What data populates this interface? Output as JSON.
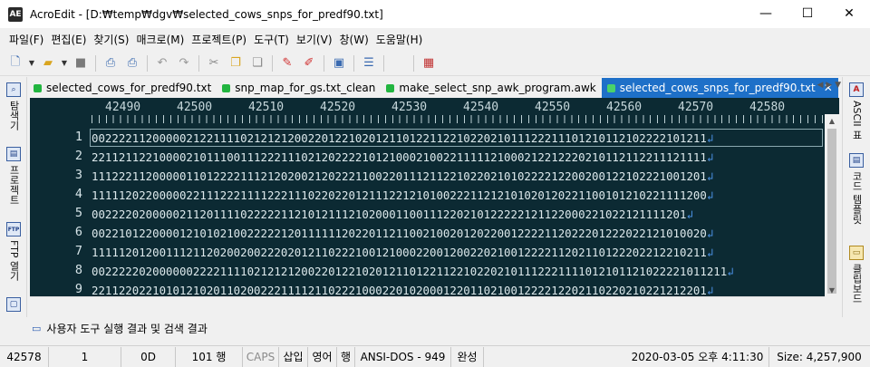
{
  "window": {
    "app_name": "AcroEdit",
    "title": "AcroEdit - [D:₩temp₩dgv₩selected_cows_snps_for_predf90.txt]",
    "app_icon": "AE",
    "controls": {
      "minimize": "—",
      "maximize": "☐",
      "close": "✕"
    }
  },
  "menu": [
    "파일(F)",
    "편집(E)",
    "찾기(S)",
    "매크로(M)",
    "프로젝트(P)",
    "도구(T)",
    "보기(V)",
    "창(W)",
    "도움말(H)"
  ],
  "toolbar_icons": [
    "new-file-icon",
    "dropdown-icon",
    "open-folder-icon",
    "dropdown-icon",
    "save-icon",
    "print-preview-icon",
    "print-icon",
    "undo-icon",
    "redo-icon",
    "cut-icon",
    "copy-icon",
    "paste-icon",
    "highlight-icon",
    "clear-icon",
    "page-icon",
    "list-icon",
    "grid-icon"
  ],
  "left_panel": {
    "tabs": [
      {
        "icon": "search-panel-icon",
        "label": "탐색기"
      },
      {
        "icon": "project-panel-icon",
        "label": "프로젝트"
      },
      {
        "icon": "ftp-panel-icon",
        "label": "FTP 열기"
      }
    ],
    "ftp_icon_text": "FTP"
  },
  "right_panel": {
    "tabs": [
      {
        "icon": "ascii-table-icon",
        "label": "ASCII 표"
      },
      {
        "icon": "code-template-icon",
        "label": "코드 템플릿"
      },
      {
        "icon": "clipboard-icon",
        "label": "클립보드"
      }
    ],
    "ascii_icon_text": "A"
  },
  "tabs": [
    {
      "label": "selected_cows_for_predf90.txt",
      "active": false
    },
    {
      "label": "snp_map_for_gs.txt_clean",
      "active": false
    },
    {
      "label": "make_select_snp_awk_program.awk",
      "active": false
    },
    {
      "label": "selected_cows_snps_for_predf90.txt",
      "active": true
    }
  ],
  "tab_close": "✕",
  "tab_nav": "◀ ▶ ▼",
  "ruler": [
    "42490",
    "42500",
    "42510",
    "42520",
    "42530",
    "42540",
    "42550",
    "42560",
    "42570",
    "42580"
  ],
  "lines": [
    {
      "no": "1",
      "text": "0022221120000021221111021212120022012210201211012211221022021011122211101210112102222101211"
    },
    {
      "no": "2",
      "text": "2211211221000021011100111222111021202222101210002100221111121000212212220210112112211121111"
    },
    {
      "no": "3",
      "text": "1112221120000011012222111212020021202221100220111211221022021010222212200200122102221001201"
    },
    {
      "no": "4",
      "text": "1111120220000022111222111122211102202201211122121010022211212101020120221100101210221111200"
    },
    {
      "no": "5",
      "text": "0022220200000211201111022222112101211121020001100111220210122222121122000221022121111201"
    },
    {
      "no": "6",
      "text": "0022101220000121010210022222120111111202201121100210020120220012222112022201222022121010020"
    },
    {
      "no": "7",
      "text": "1111120120011121120200200222020121102221001210002200120022021001222211202110122202212210211"
    },
    {
      "no": "8",
      "text": "0022222020000002222111102121212002201221020121101221122102202101112221111012101121022221011211"
    },
    {
      "no": "9",
      "text": "2211220221010121020110200222111121102221000220102000122011021001222212202110220210221212201"
    }
  ],
  "eol_mark": "↲",
  "output_bar": {
    "icon": "output-icon",
    "label": "사용자 도구 실행 결과 및 검색 결과"
  },
  "statusbar": {
    "column": "42578",
    "line": "1",
    "char_hex": "0D",
    "line_count": "101 행",
    "caps": "CAPS",
    "insert": "삽입",
    "lang": "영어",
    "mode": "행",
    "encoding": "ANSI-DOS - 949",
    "state": "완성",
    "datetime": "2020-03-05 오후 4:11:30",
    "size": "Size: 4,257,900"
  }
}
